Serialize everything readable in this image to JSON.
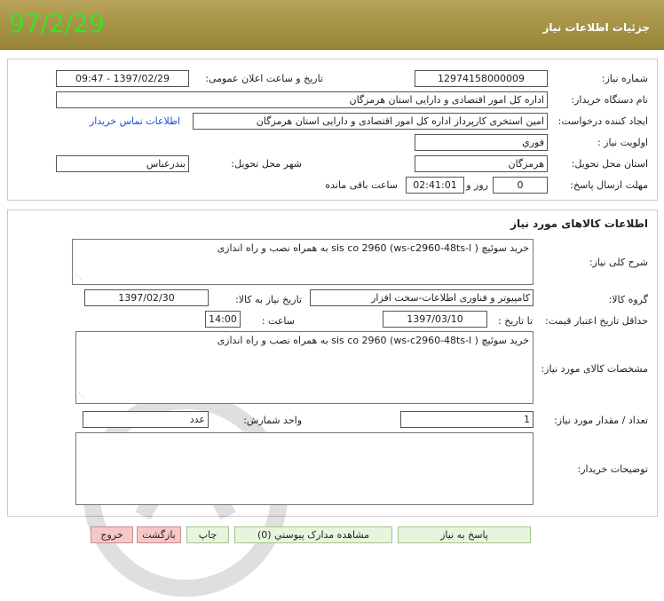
{
  "header": {
    "title": "جزئیات اطلاعات نیاز",
    "date": "97/2/29"
  },
  "info": {
    "need_number_label": "شماره نیاز:",
    "need_number": "12974158000009",
    "announce_label": "تاریخ و ساعت اعلان عمومی:",
    "announce_value": "1397/02/29 - 09:47",
    "buyer_org_label": "نام دستگاه خریدار:",
    "buyer_org": "اداره کل امور اقتصادی و دارایی استان هرمزگان",
    "creator_label": "ایجاد کننده درخواست:",
    "creator": "امین استخری کارپرداز اداره کل امور اقتصادی و دارایی استان هرمزگان",
    "contact_link": "اطلاعات تماس خریدار",
    "priority_label": "اولویت نیاز :",
    "priority": "فوري",
    "province_label": "استان محل تحویل:",
    "province": "هرمزگان",
    "city_label": "شهر محل تحویل:",
    "city": "بندرعباس",
    "deadline_label": "مهلت ارسال پاسخ:",
    "days": "0",
    "days_word": "روز و",
    "time_left": "02:41:01",
    "remaining_word": "ساعت باقی مانده"
  },
  "goods": {
    "section_title": "اطلاعات کالاهای مورد نیاز",
    "desc_label": "شرح کلی نیاز:",
    "desc": "خرید سوئیچ  ( sis co 2960  (ws-c2960-48ts-l  به همراه نصب و راه اندازی",
    "group_label": "گروه کالا:",
    "group": "کامپیوتر و فناوری اطلاعات-سخت افزار",
    "need_date_label": "تاریخ نیاز به کالا:",
    "need_date": "1397/02/30",
    "validity_label": "حداقل تاریخ اعتبار قیمت:",
    "until_date_label": "تا تاریخ :",
    "until_date": "1397/03/10",
    "hour_label": "ساعت :",
    "hour": "14:00",
    "specs_label": "مشخصات کالای مورد نیاز:",
    "specs": "خرید سوئیچ  ( sis co 2960  (ws-c2960-48ts-l  به همراه نصب و راه اندازی",
    "qty_label": "تعداد / مقدار مورد نیاز:",
    "qty": "1",
    "unit_label": "واحد شمارش:",
    "unit": "عدد",
    "buyer_notes_label": "توضیحات خریدار:",
    "buyer_notes": ""
  },
  "buttons": {
    "respond": "پاسخ به نیاز",
    "attachments": "مشاهده مدارک پیوستي (0)",
    "print": "چاپ",
    "back": "بازگشت",
    "exit": "خروج"
  },
  "colors": {
    "header_bg": "#a8953f",
    "date_green": "#3fe02a",
    "link_blue": "#1a4fd6"
  }
}
